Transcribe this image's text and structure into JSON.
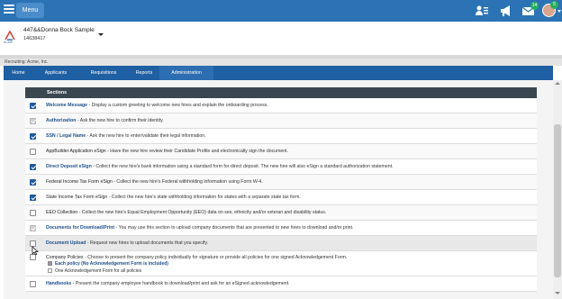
{
  "header": {
    "menu_label": "Menu",
    "icons": [
      "hamburger-icon",
      "people-icon",
      "megaphone-icon",
      "mail-icon",
      "avatar"
    ],
    "mail_badge": "14",
    "avatar_badge": "5"
  },
  "company": {
    "logo_text": "ACME",
    "name": "447&&Donna Bock Sample",
    "id": "14638417"
  },
  "recruiting_label": "Recruiting: Acme, Inc.",
  "nav": {
    "tabs": [
      {
        "label": "Home"
      },
      {
        "label": "Applicants"
      },
      {
        "label": "Requisitions"
      },
      {
        "label": "Reports"
      },
      {
        "label": "Administration"
      }
    ],
    "active": "Administration"
  },
  "sections": {
    "header": "Sections",
    "rows": [
      {
        "title": "Welcome Message",
        "desc": " - Display a custom greeting to welcome new hires and explain the onboarding process.",
        "state": "checked",
        "title_style": "link"
      },
      {
        "title": "Authorization",
        "desc": " - Ask the new hire to confirm their identity.",
        "state": "disabled",
        "title_style": "link"
      },
      {
        "title": "SSN / Legal Name",
        "desc": " - Ask the new hire to enter/validate their legal information.",
        "state": "checked",
        "title_style": "link"
      },
      {
        "title": "AppBuilder Application eSign",
        "desc": " - Have the new hire review their Candidate Profile and electronically sign the document.",
        "state": "unchecked",
        "title_style": "plain"
      },
      {
        "title": "Direct Deposit eSign",
        "desc": " - Collect the new hire's bank information using a standard form for direct deposit. The new hire will also eSign a standard authorization statement.",
        "state": "checked",
        "title_style": "link"
      },
      {
        "title": "Federal Income Tax Form eSign",
        "desc": " - Collect the new hire's Federal withholding information using Form W-4.",
        "state": "checked",
        "title_style": "plain"
      },
      {
        "title": "State Income Tax Form eSign",
        "desc": " - Collect the new hire's state withholding information for states with a separate state tax form.",
        "state": "checked",
        "title_style": "plain"
      },
      {
        "title": "EEO Collection",
        "desc": " - Collect the new hire's Equal Employment Opportunity (EEO) data on sex, ethnicity and/or veteran and disability status.",
        "state": "unchecked",
        "title_style": "plain"
      },
      {
        "title": "Documents for Download/Print",
        "desc": " - You may use this section to upload company documents that are presented to new hires to download and/or print.",
        "state": "disabled",
        "title_style": "link"
      },
      {
        "title": "Document Upload",
        "desc": " - Request new hires to upload documents that you specify.",
        "state": "unchecked",
        "title_style": "link"
      }
    ],
    "policies": {
      "title": "Company Policies",
      "desc": " - Choose to present the company policy individually for signature or provide all policies for one signed Acknowledgement Form.",
      "options": [
        {
          "label": "Each policy (No Acknowledgement Form is included)",
          "checked": true
        },
        {
          "label": "One Acknowledgement Form for all policies",
          "checked": false
        }
      ]
    },
    "handbooks": {
      "title": "Handbooks",
      "desc": " - Present the company employee handbook to download/print and ask for an eSigned acknowledgement."
    }
  },
  "colors": {
    "topbar": "#2b73b5",
    "nav": "#1f5fa3",
    "section_header": "#3a4650",
    "link": "#1e4f8c",
    "checkbox_checked": "#1e5a9c"
  }
}
